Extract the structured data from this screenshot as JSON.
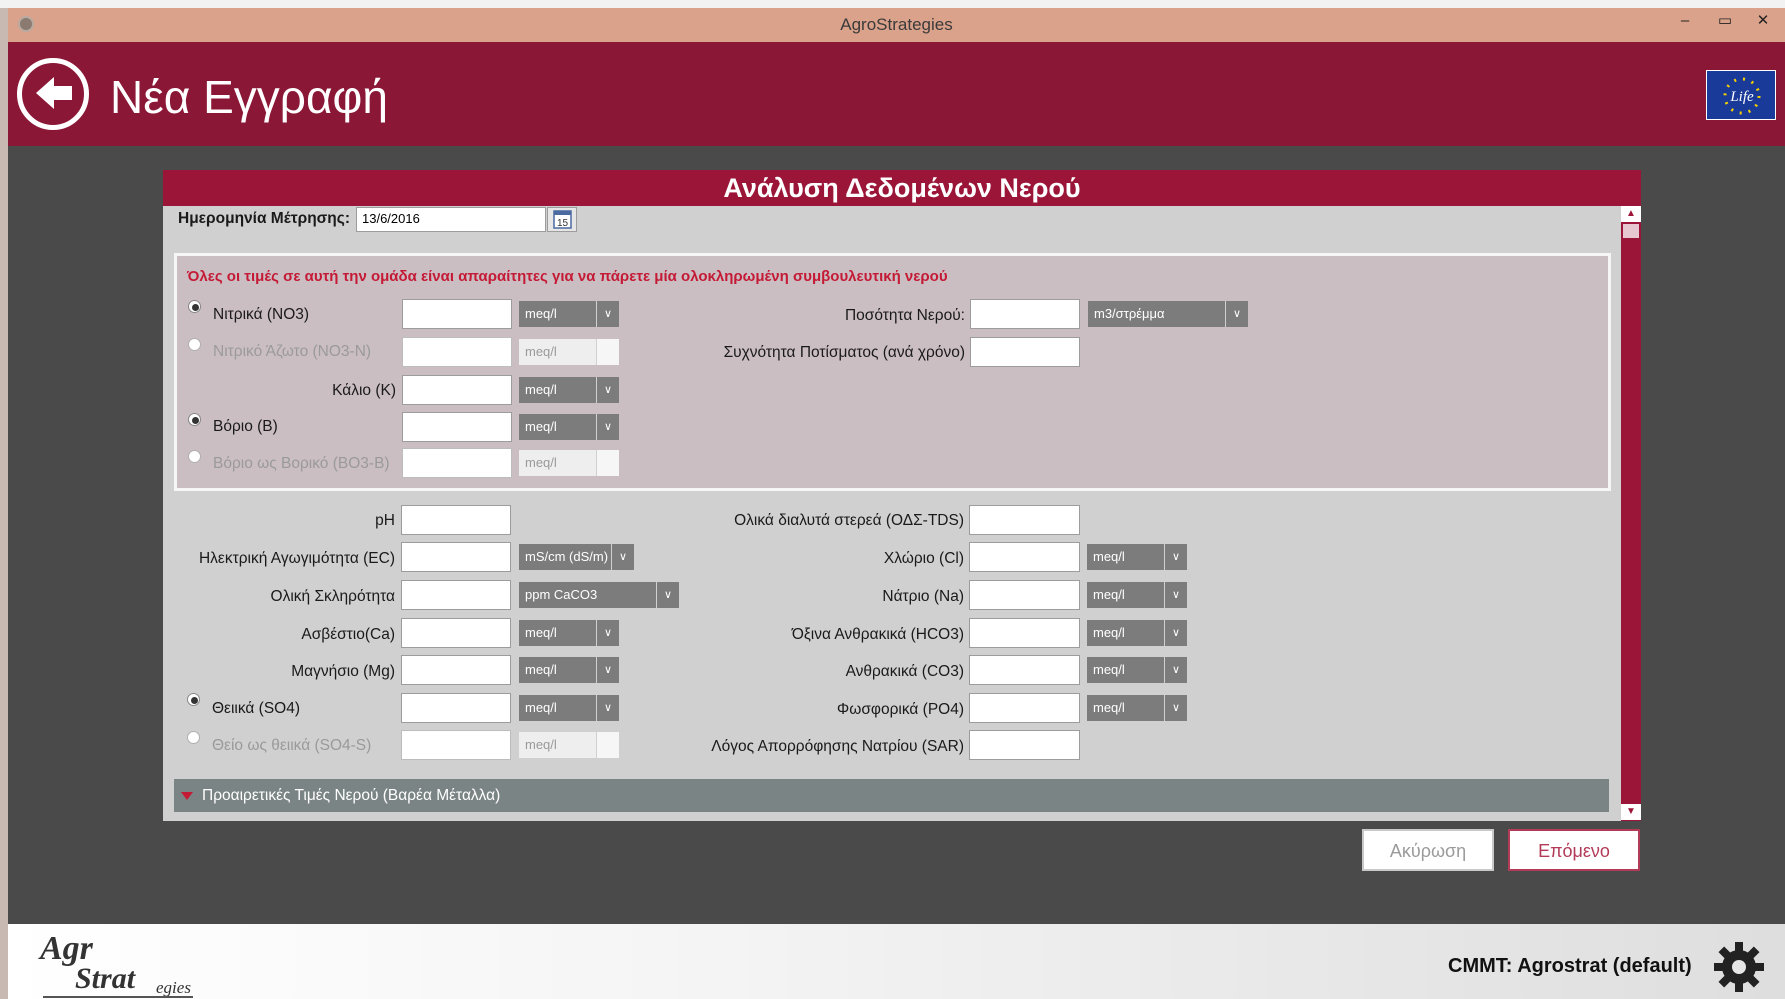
{
  "window": {
    "title": "AgroStrategies",
    "minimize": "–",
    "maximize": "▭",
    "close": "✕"
  },
  "header": {
    "title": "Νέα Εγγραφή",
    "logo_text": "Life"
  },
  "panel": {
    "title": "Ανάλυση Δεδομένων Νερού",
    "date_label": "Ημερομηνία Μέτρησης:",
    "date_value": "13/6/2016",
    "calendar_day": "15",
    "required_note": "Όλες οι τιμές σε αυτή την ομάδα είναι απαραίτητες για να πάρετε μία ολοκληρωμένη συμβουλευτική νερού",
    "required": {
      "nitrates": {
        "label": "Νιτρικά (NO3)",
        "unit": "meq/l",
        "selected": true
      },
      "nitrate_n": {
        "label": "Νιτρικό Άζωτο (NO3-N)",
        "unit": "meq/l",
        "selected": false
      },
      "potassium": {
        "label": "Κάλιο (K)",
        "unit": "meq/l"
      },
      "boron": {
        "label": "Βόριο (B)",
        "unit": "meq/l",
        "selected": true
      },
      "boron_b": {
        "label": "Βόριο ως Βορικό (BO3-B)",
        "unit": "meq/l",
        "selected": false
      },
      "water_amount": {
        "label": "Ποσότητα Νερού:",
        "unit": "m3/στρέμμα"
      },
      "irrigation_freq": {
        "label": "Συχνότητα Ποτίσματος (ανά χρόνο)"
      }
    },
    "left": {
      "ph": {
        "label": "pH"
      },
      "ec": {
        "label": "Ηλεκτρική Αγωγιμότητα (EC)",
        "unit": "mS/cm (dS/m)"
      },
      "hardness": {
        "label": "Ολική Σκληρότητα",
        "unit": "ppm CaCO3"
      },
      "calcium": {
        "label": "Ασβέστιο(Ca)",
        "unit": "meq/l"
      },
      "magnesium": {
        "label": "Μαγνήσιο (Mg)",
        "unit": "meq/l"
      },
      "sulfates": {
        "label": "Θειικά (SO4)",
        "unit": "meq/l",
        "selected": true
      },
      "sulfur": {
        "label": "Θείο ως θειικά (SO4-S)",
        "unit": "meq/l",
        "selected": false
      }
    },
    "right": {
      "tds": {
        "label": "Ολικά διαλυτά στερεά (ΟΔΣ-TDS)"
      },
      "chloride": {
        "label": "Χλώριο (Cl)",
        "unit": "meq/l"
      },
      "sodium": {
        "label": "Νάτριο (Na)",
        "unit": "meq/l"
      },
      "bicarbonate": {
        "label": "Όξινα Ανθρακικά (HCO3)",
        "unit": "meq/l"
      },
      "carbonate": {
        "label": "Ανθρακικά (CO3)",
        "unit": "meq/l"
      },
      "phosphate": {
        "label": "Φωσφορικά (PO4)",
        "unit": "meq/l"
      },
      "sar": {
        "label": "Λόγος Απορρόφησης Νατρίου (SAR)"
      }
    },
    "optional_label": "Προαιρετικές Τιμές Νερού (Βαρέα Μέταλλα)"
  },
  "actions": {
    "cancel": "Ακύρωση",
    "next": "Επόμενο"
  },
  "footer": {
    "logo_agro": "Agr",
    "logo_strat": "Strat",
    "logo_egies": "egies",
    "cmmt": "CMMT: Agrostrat (default)"
  },
  "colors": {
    "header": "#8b1736",
    "accent": "#9a1537",
    "required_text": "#c41a35"
  }
}
